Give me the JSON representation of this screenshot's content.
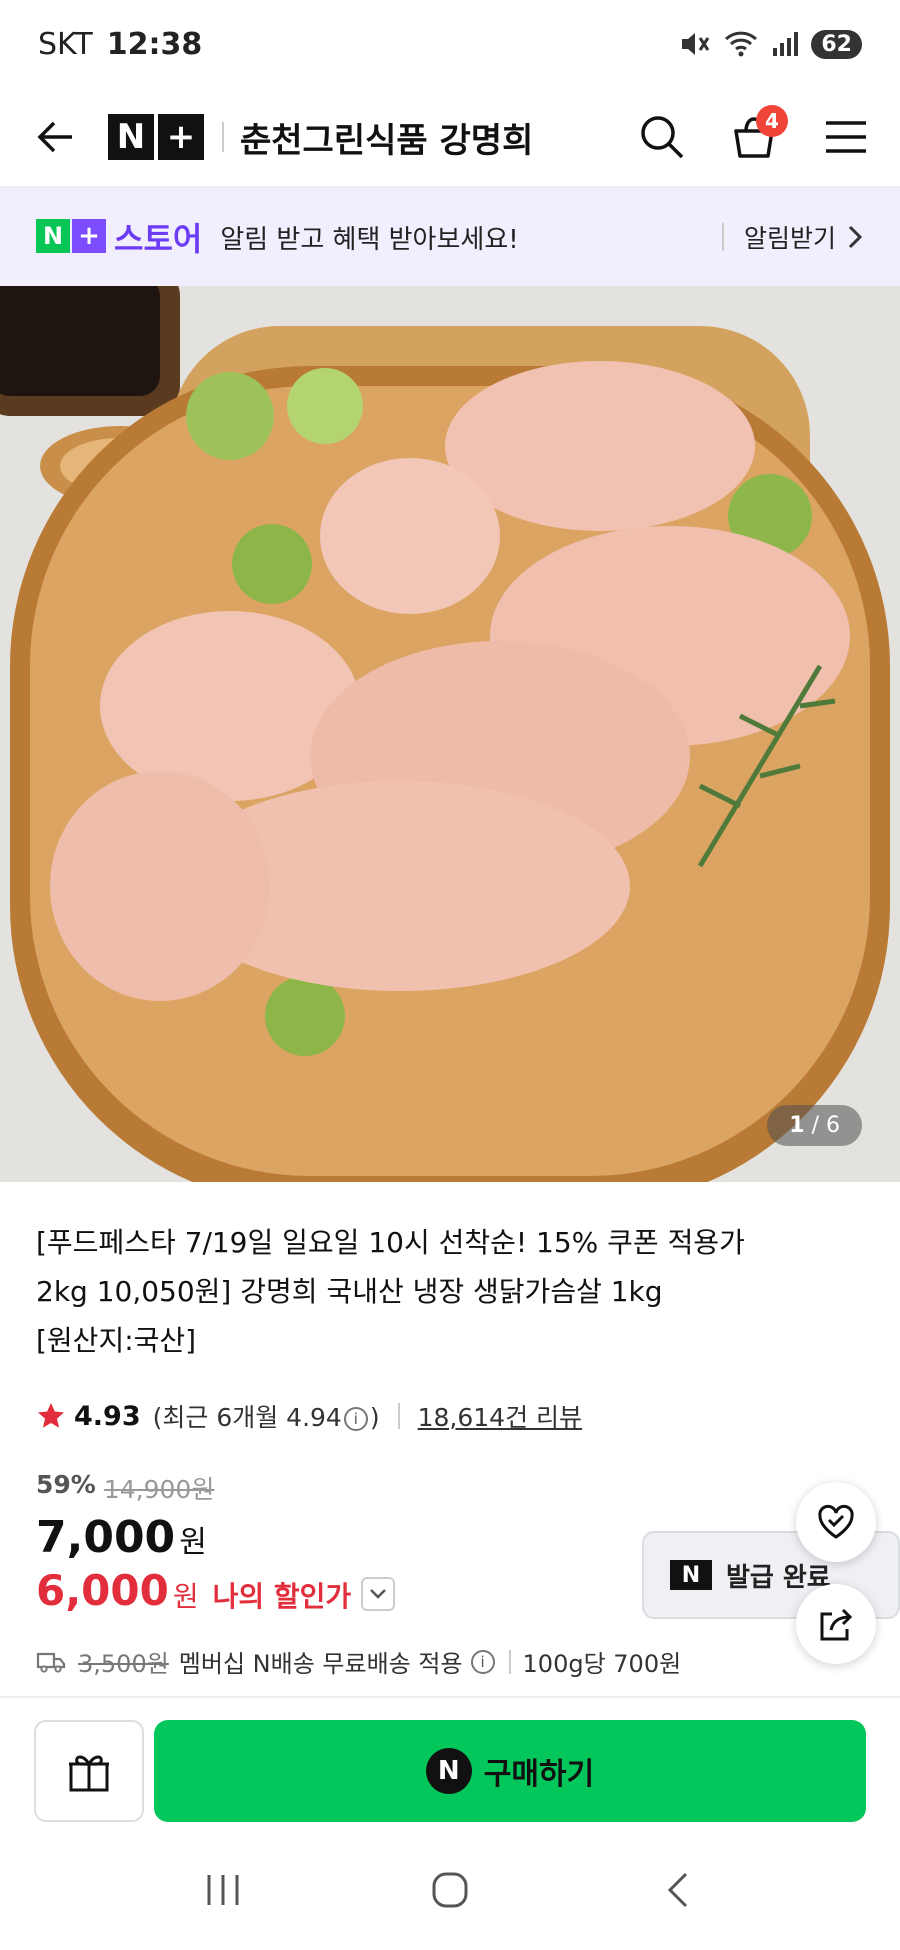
{
  "status_bar": {
    "carrier": "SKT",
    "time": "12:38",
    "battery": "62"
  },
  "header": {
    "logo_n": "N",
    "logo_plus": "+",
    "store_name": "춘천그린식품 강명희",
    "cart_count": "4"
  },
  "banner": {
    "logo_n": "N",
    "logo_plus": "+",
    "store_label": "스토어",
    "message": "알림 받고 혜택 받아보세요!",
    "action": "알림받기"
  },
  "image": {
    "current": "1",
    "separator": " / ",
    "total": "6"
  },
  "product": {
    "title_line1": "[푸드페스타 7/19일 일요일 10시 선착순! 15% 쿠폰 적용가",
    "title_line2": "2kg 10,050원] 강명희 국내산 냉장 생닭가슴살 1kg",
    "title_line3": "[원산지:국산]",
    "rating": "4.93",
    "recent_rating_prefix": "(최근 6개월 4.94",
    "recent_rating_suffix": ")",
    "review_count": "18,614건 리뷰",
    "discount_percent": "59%",
    "original_price": "14,900원",
    "price": "7,000",
    "price_unit": "원",
    "my_price": "6,000",
    "my_price_unit": "원",
    "my_price_label": "나의 할인가",
    "coupon_n": "N",
    "coupon_label": "발급 완료",
    "shipping_original": "3,500원",
    "shipping_text": "멤버십 N배송 무료배송 적용",
    "unit_price": "100g당 700원"
  },
  "bottom": {
    "buy_n": "N",
    "buy_label": "구매하기"
  },
  "colors": {
    "brand_green": "#03c75a",
    "brand_purple": "#6c3cf5",
    "sale_red": "#e22e3c",
    "badge_red": "#f04438"
  }
}
